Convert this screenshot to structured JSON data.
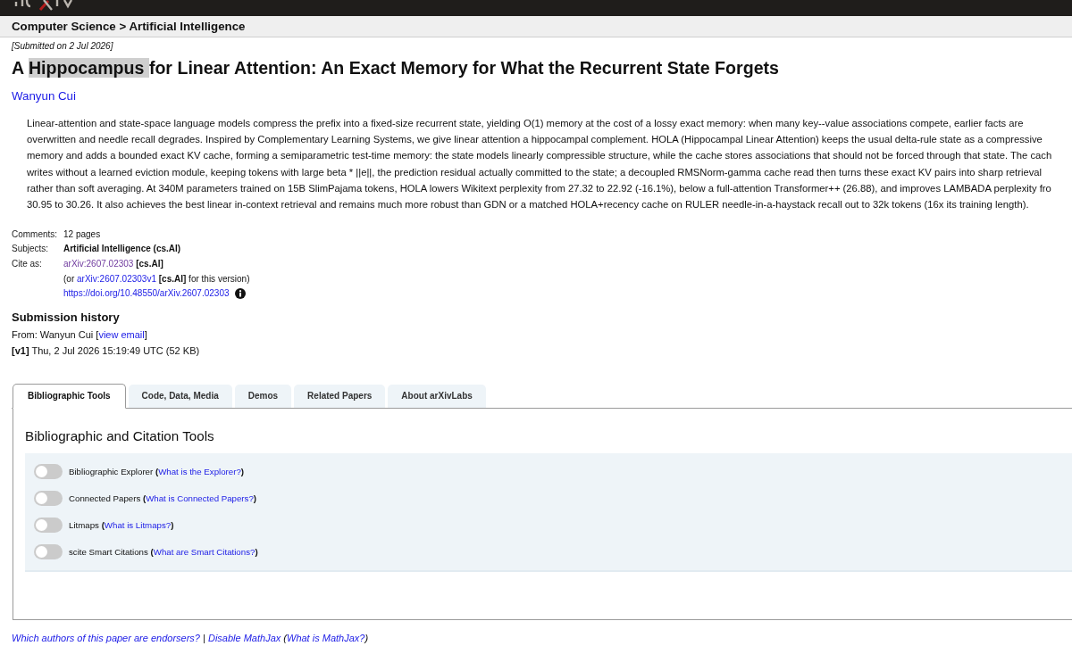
{
  "header": {
    "breadcrumb": "Computer Science > Artificial Intelligence"
  },
  "submitted": "[Submitted on 2 Jul 2026]",
  "title_parts": [
    {
      "text": "A ",
      "highlighted": false
    },
    {
      "text": "Hippocampus ",
      "highlighted": true
    },
    {
      "text": "for Linear Attention: An Exact Memory for What the Recurrent State Forgets",
      "highlighted": false
    }
  ],
  "authors": [
    "Wanyun Cui"
  ],
  "abstract_lines": [
    "Linear-attention and state-space language models compress the prefix into a fixed-size recurrent state, yielding O(1) memory at the cost of a lossy exact memory: when many key--value associations compete, earlier facts are",
    "overwritten and needle recall degrades. Inspired by Complementary Learning Systems, we give linear attention a hippocampal complement. HOLA (Hippocampal Linear Attention) keeps the usual delta-rule state as a compressive",
    "memory and adds a bounded exact KV cache, forming a semiparametric test-time memory: the state models linearly compressible structure, while the cache stores associations that should not be forced through that state. The cach",
    "writes without a learned eviction module, keeping tokens with large beta * ||e||, the prediction residual actually committed to the state; a decoupled RMSNorm-gamma cache read then turns these exact KV pairs into sharp retrieval",
    "rather than soft averaging. At 340M parameters trained on 15B SlimPajama tokens, HOLA lowers Wikitext perplexity from 27.32 to 22.92 (-16.1%), below a full-attention Transformer++ (26.88), and improves LAMBADA perplexity fro",
    "30.95 to 30.26. It also achieves the best linear in-context retrieval and remains much more robust than GDN or a matched HOLA+recency cache on RULER needle-in-a-haystack recall out to 32k tokens (16x its training length)."
  ],
  "metadata": {
    "comments": {
      "label": "Comments:",
      "value": "12 pages"
    },
    "subjects": {
      "label": "Subjects:",
      "value": "Artificial Intelligence (cs.AI)"
    },
    "cite_as": {
      "label": "Cite as:",
      "primary": {
        "link": "arXiv:2607.02303",
        "visited": true,
        "suffix": "**[cs.AI]**"
      },
      "version": {
        "prefix": "(or",
        "link": "arXiv:2607.02303v1",
        "visited": false,
        "suffix": "**[cs.AI]** for this version)"
      },
      "doi": "https://doi.org/10.48550/arXiv.2607.02303"
    }
  },
  "submission_history": {
    "heading": "Submission history",
    "from": {
      "prefix": "From: Wanyun Cui [",
      "link": "view email",
      "suffix": "]"
    },
    "versions": [
      "**[v1]** Thu, 2 Jul 2026 15:19:49 UTC (52 KB)"
    ]
  },
  "tabs": [
    {
      "label": "Bibliographic Tools",
      "selected": true
    },
    {
      "label": "Code, Data, Media",
      "selected": false
    },
    {
      "label": "Demos",
      "selected": false
    },
    {
      "label": "Related Papers",
      "selected": false
    },
    {
      "label": "About arXivLabs",
      "selected": false
    }
  ],
  "bib_tools": {
    "heading": "Bibliographic and Citation Tools",
    "tools": [
      {
        "label": "Bibliographic Explorer **(**",
        "link": "What is the Explorer?",
        "close": "**)**",
        "on": false
      },
      {
        "label": "Connected Papers **(**",
        "link": "What is Connected Papers?",
        "close": "**)**",
        "on": false
      },
      {
        "label": "Litmaps **(**",
        "link": "What is Litmaps?",
        "close": "**)**",
        "on": false
      },
      {
        "label": "scite Smart Citations **(**",
        "link": "What are Smart Citations?",
        "close": "**)**",
        "on": false
      }
    ]
  },
  "footer": {
    "endorsers_link": "Which authors of this paper are endorsers?",
    "separator": "|",
    "mathjax_link": "Disable MathJax",
    "open": "(",
    "help_link": "What is MathJax?",
    "close": ")"
  }
}
